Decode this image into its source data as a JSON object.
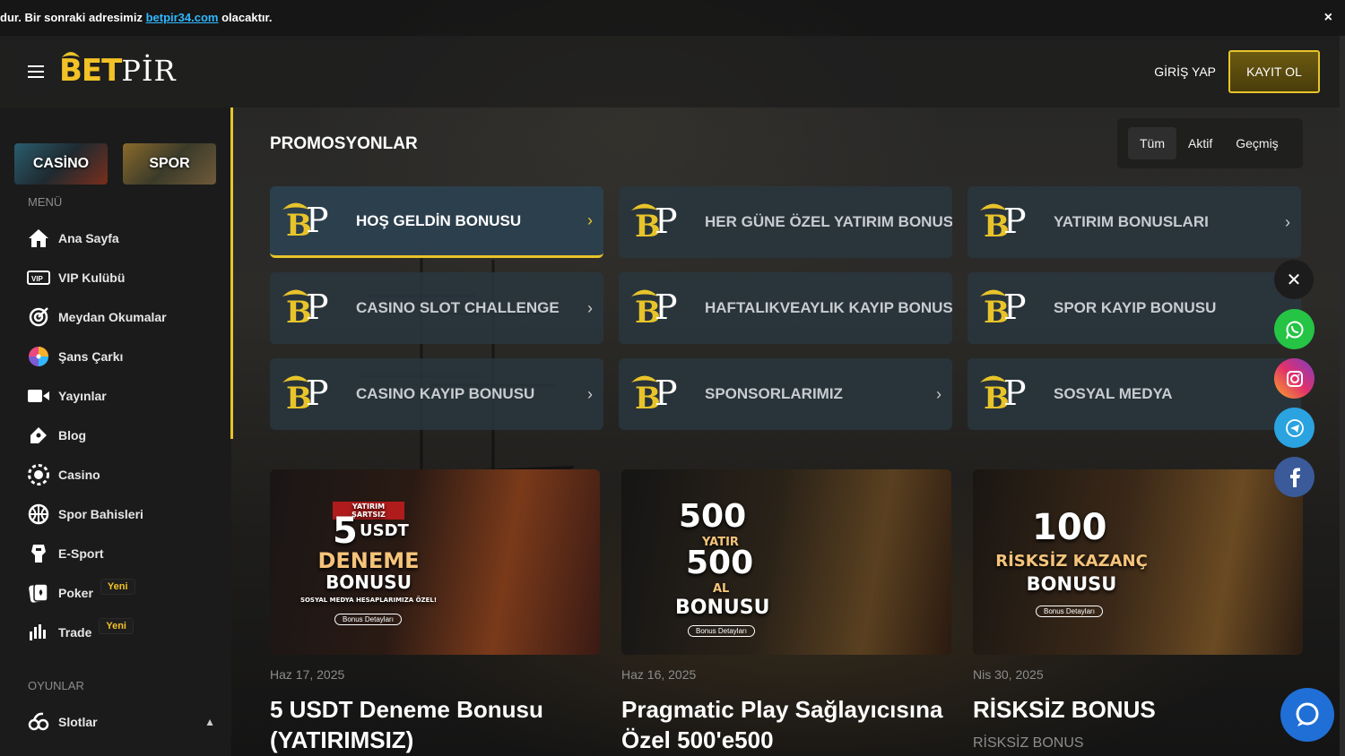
{
  "notice": {
    "text_before": "dur. Bir sonraki adresimiz ",
    "link": "betpir34.com",
    "text_after": " olacaktır.",
    "close": "×"
  },
  "header": {
    "logo_bet": "BET",
    "logo_pir": "PİR",
    "login_label": "GİRİŞ YAP",
    "register_label": "KAYIT OL"
  },
  "sidebar": {
    "tiles": {
      "casino": "CASİNO",
      "spor": "SPOR"
    },
    "menu_label": "MENÜ",
    "items": [
      {
        "label": "Ana Sayfa",
        "icon": "home-icon"
      },
      {
        "label": "VIP Kulübü",
        "icon": "vip-icon"
      },
      {
        "label": "Meydan Okumalar",
        "icon": "target-icon"
      },
      {
        "label": "Şans Çarkı",
        "icon": "wheel-icon"
      },
      {
        "label": "Yayınlar",
        "icon": "video-icon"
      },
      {
        "label": "Blog",
        "icon": "blog-icon"
      },
      {
        "label": "Casino",
        "icon": "casino-chip-icon"
      },
      {
        "label": "Spor Bahisleri",
        "icon": "basketball-icon"
      },
      {
        "label": "E-Sport",
        "icon": "esport-icon"
      },
      {
        "label": "Poker",
        "icon": "poker-icon",
        "badge": "Yeni"
      },
      {
        "label": "Trade",
        "icon": "trade-icon",
        "badge": "Yeni"
      }
    ],
    "games_label": "OYUNLAR",
    "games_items": [
      {
        "label": "Slotlar",
        "icon": "slot-icon"
      }
    ]
  },
  "main": {
    "title": "PROMOSYONLAR",
    "filters": [
      "Tüm",
      "Aktif",
      "Geçmiş"
    ],
    "promos": [
      {
        "label": "HOŞ GELDİN BONUSU"
      },
      {
        "label": "HER GÜNE ÖZEL YATIRIM BONUSU"
      },
      {
        "label": "YATIRIM BONUSLARI"
      },
      {
        "label": "CASINO SLOT CHALLENGE"
      },
      {
        "label": "HAFTALIKVEAYLIK KAYIP BONUSU"
      },
      {
        "label": "SPOR KAYIP BONUSU"
      },
      {
        "label": "CASINO KAYIP BONUSU"
      },
      {
        "label": "SPONSORLARIMIZ"
      },
      {
        "label": "SOSYAL MEDYA"
      }
    ],
    "promo_chevron": "›",
    "cards": [
      {
        "date": "Haz 17, 2025",
        "title": "5 USDT Deneme Bonusu (YATIRIMSIZ)",
        "subtitle": "",
        "image": {
          "top": "YATIRIM ŞARTSIZ",
          "big": "5",
          "big_unit": "USDT",
          "line1": "DENEME",
          "line2": "BONUSU",
          "note": "SOSYAL MEDYA HESAPLARIMIZA ÖZEL!",
          "button": "Bonus Detayları"
        }
      },
      {
        "date": "Haz 16, 2025",
        "title": "Pragmatic Play Sağlayıcısına Özel 500'e500",
        "subtitle": "",
        "image": {
          "big1": "500",
          "mid1": "YATIR",
          "big2": "500",
          "mid2": "AL",
          "line": "BONUSU",
          "button": "Bonus Detayları"
        }
      },
      {
        "date": "Nis 30, 2025",
        "title": "RİSKSİZ BONUS",
        "subtitle": "RİSKSİZ BONUS",
        "image": {
          "big": "100",
          "line1": "RİSKSİZ KAZANÇ",
          "line2": "BONUSU",
          "button": "Bonus Detayları"
        }
      }
    ]
  },
  "social": {
    "close": "✕",
    "items": [
      "whatsapp-icon",
      "instagram-icon",
      "telegram-icon",
      "facebook-icon"
    ]
  },
  "colors": {
    "accent": "#e8c42a",
    "link": "#2fb8ff",
    "whatsapp": "#25c445",
    "telegram": "#2aa3e0",
    "facebook": "#3a5a99",
    "chat": "#1f6fd6"
  }
}
